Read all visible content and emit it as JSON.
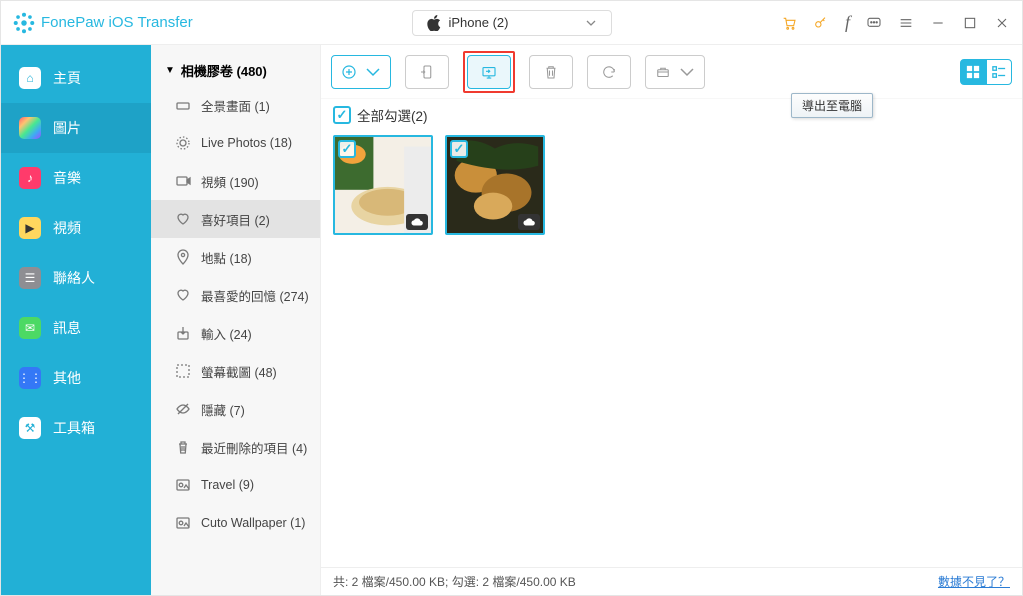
{
  "app": {
    "title": "FonePaw iOS Transfer"
  },
  "device": {
    "name": "iPhone (2)"
  },
  "sidebar": [
    {
      "id": "home",
      "label": "主頁"
    },
    {
      "id": "photos",
      "label": "圖片"
    },
    {
      "id": "music",
      "label": "音樂"
    },
    {
      "id": "video",
      "label": "視頻"
    },
    {
      "id": "contacts",
      "label": "聯絡人"
    },
    {
      "id": "messages",
      "label": "訊息"
    },
    {
      "id": "other",
      "label": "其他"
    },
    {
      "id": "toolbox",
      "label": "工具箱"
    }
  ],
  "sidebar_active": "photos",
  "sublist": {
    "header": "相機膠卷 (480)",
    "selected": "favorites",
    "items": [
      {
        "id": "panorama",
        "label": "全景畫面 (1)"
      },
      {
        "id": "livephotos",
        "label": "Live Photos (18)"
      },
      {
        "id": "videos",
        "label": "視頻 (190)"
      },
      {
        "id": "favorites",
        "label": "喜好項目 (2)"
      },
      {
        "id": "places",
        "label": "地點 (18)"
      },
      {
        "id": "memories",
        "label": "最喜愛的回憶 (274)"
      },
      {
        "id": "imports",
        "label": "輸入 (24)"
      },
      {
        "id": "screenshots",
        "label": "螢幕截圖 (48)"
      },
      {
        "id": "hidden",
        "label": "隱藏 (7)"
      },
      {
        "id": "recentlydeleted",
        "label": "最近刪除的項目 (4)"
      },
      {
        "id": "travel",
        "label": "Travel (9)"
      },
      {
        "id": "cuto",
        "label": "Cuto Wallpaper (1)"
      }
    ]
  },
  "toolbar": {
    "tooltip": "導出至電腦",
    "highlighted": "export-to-pc"
  },
  "content": {
    "select_all_label": "全部勾選(2)",
    "select_all_checked": true,
    "thumbs": [
      {
        "id": "img1",
        "checked": true,
        "cloud": true
      },
      {
        "id": "img2",
        "checked": true,
        "cloud": true
      }
    ]
  },
  "status": {
    "text": "共: 2 檔案/450.00 KB; 勾選: 2 檔案/450.00 KB",
    "help_link": "數據不見了？"
  },
  "colors": {
    "accent": "#27b8e0",
    "sidebar": "#22b0d6",
    "highlight": "#f03a2f"
  }
}
